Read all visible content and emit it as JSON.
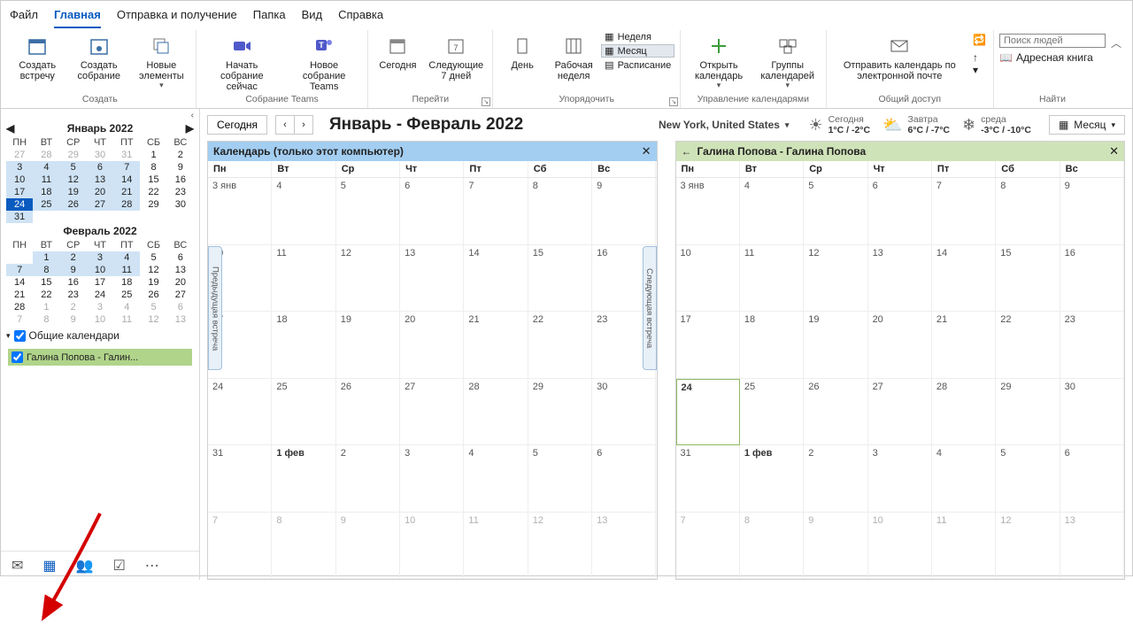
{
  "menubar": [
    "Файл",
    "Главная",
    "Отправка и получение",
    "Папка",
    "Вид",
    "Справка"
  ],
  "active_tab": 1,
  "ribbon": {
    "groups": [
      {
        "name": "Создать",
        "buttons": [
          "Создать встречу",
          "Создать собрание",
          "Новые элементы"
        ]
      },
      {
        "name": "Собрание Teams",
        "buttons": [
          "Начать собрание сейчас",
          "Новое собрание Teams"
        ]
      },
      {
        "name": "Перейти",
        "buttons": [
          "Сегодня",
          "Следующие 7 дней"
        ]
      },
      {
        "name": "Упорядочить",
        "buttons": [
          "День",
          "Рабочая неделя"
        ],
        "stack": [
          "Неделя",
          "Месяц",
          "Расписание"
        ],
        "pressed": "Месяц"
      },
      {
        "name": "Управление календарями",
        "buttons": [
          "Открыть календарь",
          "Группы календарей"
        ]
      },
      {
        "name": "Общий доступ",
        "buttons": [
          "Отправить календарь по электронной почте"
        ]
      },
      {
        "name": "Найти",
        "search_placeholder": "Поиск людей",
        "address": "Адресная книга"
      }
    ]
  },
  "sidebar": {
    "month1": {
      "title": "Январь 2022",
      "dow": [
        "ПН",
        "ВТ",
        "СР",
        "ЧТ",
        "ПТ",
        "СБ",
        "ВС"
      ],
      "rows": [
        [
          {
            "n": 27,
            "d": 1
          },
          {
            "n": 28,
            "d": 1
          },
          {
            "n": 29,
            "d": 1
          },
          {
            "n": 30,
            "d": 1
          },
          {
            "n": 31,
            "d": 1
          },
          {
            "n": 1
          },
          {
            "n": 2
          }
        ],
        [
          {
            "n": 3,
            "h": 1
          },
          {
            "n": 4,
            "h": 1
          },
          {
            "n": 5,
            "h": 1
          },
          {
            "n": 6,
            "h": 1
          },
          {
            "n": 7,
            "h": 1
          },
          {
            "n": 8
          },
          {
            "n": 9
          }
        ],
        [
          {
            "n": 10,
            "h": 1
          },
          {
            "n": 11,
            "h": 1
          },
          {
            "n": 12,
            "h": 1
          },
          {
            "n": 13,
            "h": 1
          },
          {
            "n": 14,
            "h": 1
          },
          {
            "n": 15
          },
          {
            "n": 16
          }
        ],
        [
          {
            "n": 17,
            "h": 1
          },
          {
            "n": 18,
            "h": 1
          },
          {
            "n": 19,
            "h": 1
          },
          {
            "n": 20,
            "h": 1
          },
          {
            "n": 21,
            "h": 1
          },
          {
            "n": 22
          },
          {
            "n": 23
          }
        ],
        [
          {
            "n": 24,
            "t": 1
          },
          {
            "n": 25,
            "h": 1
          },
          {
            "n": 26,
            "h": 1
          },
          {
            "n": 27,
            "h": 1
          },
          {
            "n": 28,
            "h": 1
          },
          {
            "n": 29
          },
          {
            "n": 30
          }
        ],
        [
          {
            "n": 31,
            "h": 1
          },
          {
            "n": "",
            "e": 1
          },
          {
            "n": "",
            "e": 1
          },
          {
            "n": "",
            "e": 1
          },
          {
            "n": "",
            "e": 1
          },
          {
            "n": "",
            "e": 1
          },
          {
            "n": "",
            "e": 1
          }
        ]
      ]
    },
    "month2": {
      "title": "Февраль 2022",
      "dow": [
        "ПН",
        "ВТ",
        "СР",
        "ЧТ",
        "ПТ",
        "СБ",
        "ВС"
      ],
      "rows": [
        [
          {
            "n": "",
            "e": 1
          },
          {
            "n": 1,
            "h": 1
          },
          {
            "n": 2,
            "h": 1
          },
          {
            "n": 3,
            "h": 1
          },
          {
            "n": 4,
            "h": 1
          },
          {
            "n": 5
          },
          {
            "n": 6
          }
        ],
        [
          {
            "n": 7,
            "h": 1
          },
          {
            "n": 8,
            "h": 1
          },
          {
            "n": 9,
            "h": 1
          },
          {
            "n": 10,
            "h": 1
          },
          {
            "n": 11,
            "h": 1
          },
          {
            "n": 12
          },
          {
            "n": 13
          }
        ],
        [
          {
            "n": 14
          },
          {
            "n": 15
          },
          {
            "n": 16
          },
          {
            "n": 17
          },
          {
            "n": 18
          },
          {
            "n": 19
          },
          {
            "n": 20
          }
        ],
        [
          {
            "n": 21
          },
          {
            "n": 22
          },
          {
            "n": 23
          },
          {
            "n": 24
          },
          {
            "n": 25
          },
          {
            "n": 26
          },
          {
            "n": 27
          }
        ],
        [
          {
            "n": 28
          },
          {
            "n": 1,
            "d": 1
          },
          {
            "n": 2,
            "d": 1
          },
          {
            "n": 3,
            "d": 1
          },
          {
            "n": 4,
            "d": 1
          },
          {
            "n": 5,
            "d": 1
          },
          {
            "n": 6,
            "d": 1
          }
        ],
        [
          {
            "n": 7,
            "d": 1
          },
          {
            "n": 8,
            "d": 1
          },
          {
            "n": 9,
            "d": 1
          },
          {
            "n": 10,
            "d": 1
          },
          {
            "n": 11,
            "d": 1
          },
          {
            "n": 12,
            "d": 1
          },
          {
            "n": 13,
            "d": 1
          }
        ]
      ]
    },
    "shared_header": "Общие календари",
    "shared_item": "Галина Попова - Галин..."
  },
  "topbar": {
    "today": "Сегодня",
    "title": "Январь - Февраль 2022",
    "location": "New York, United States",
    "weather": [
      {
        "day": "Сегодня",
        "temps": "1°C / -2°C"
      },
      {
        "day": "Завтра",
        "temps": "6°C / -7°C"
      },
      {
        "day": "среда",
        "temps": "-3°C / -10°C"
      }
    ],
    "view": "Месяц"
  },
  "calendars": {
    "left": {
      "title": "Календарь (только этот компьютер)",
      "color": "blue"
    },
    "right": {
      "title": "Галина Попова - Галина Попова",
      "color": "green"
    },
    "dow": [
      "Пн",
      "Вт",
      "Ср",
      "Чт",
      "Пт",
      "Сб",
      "Вс"
    ],
    "rows": [
      [
        "3 янв",
        "4",
        "5",
        "6",
        "7",
        "8",
        "9"
      ],
      [
        "10",
        "11",
        "12",
        "13",
        "14",
        "15",
        "16"
      ],
      [
        "17",
        "18",
        "19",
        "20",
        "21",
        "22",
        "23"
      ],
      [
        "24",
        "25",
        "26",
        "27",
        "28",
        "29",
        "30"
      ],
      [
        "31",
        "1 фев",
        "2",
        "3",
        "4",
        "5",
        "6"
      ],
      [
        "7",
        "8",
        "9",
        "10",
        "11",
        "12",
        "13"
      ]
    ],
    "dim_row": 5,
    "bold": [
      [
        "1 фев"
      ],
      [
        "24",
        "1 фев"
      ]
    ],
    "left_handles": {
      "prev": "Предыдущая встреча",
      "next": "Следующая встреча"
    },
    "right_today": "24"
  }
}
